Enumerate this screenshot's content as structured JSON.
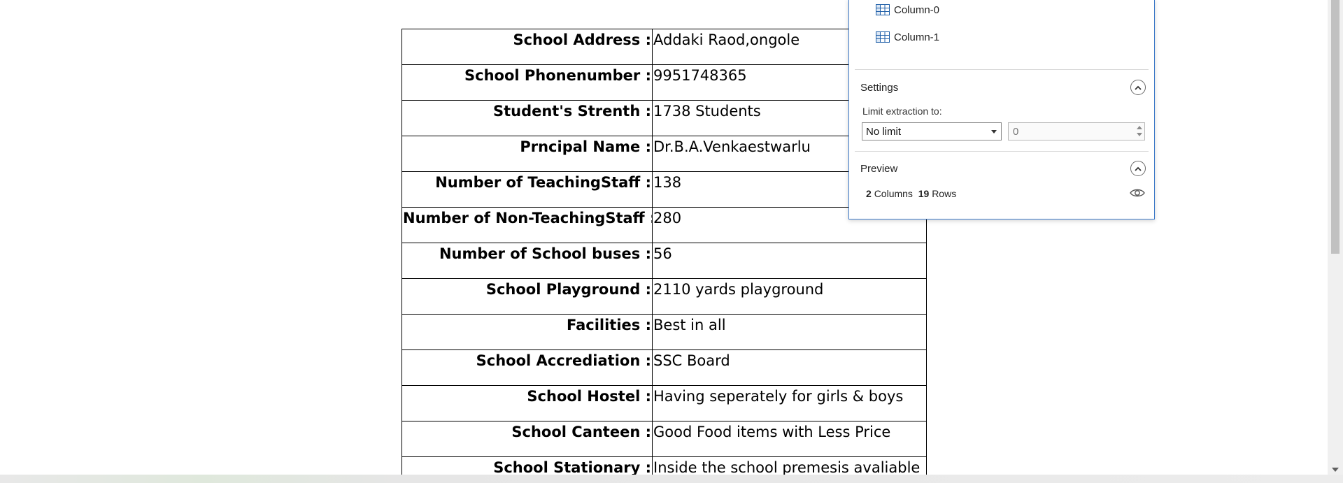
{
  "school_table": {
    "rows": [
      {
        "label": "School Address :",
        "value": "Addaki Raod,ongole"
      },
      {
        "label": "School Phonenumber :",
        "value": "9951748365"
      },
      {
        "label": "Student's Strenth :",
        "value": "1738 Students"
      },
      {
        "label": "Prncipal Name :",
        "value": "Dr.B.A.Venkaestwarlu"
      },
      {
        "label": "Number of TeachingStaff :",
        "value": "138"
      },
      {
        "label": "Number of Non-TeachingStaff :",
        "value": "280"
      },
      {
        "label": "Number of School buses :",
        "value": "56"
      },
      {
        "label": "School Playground :",
        "value": "2110 yards playground"
      },
      {
        "label": "Facilities :",
        "value": "Best in all"
      },
      {
        "label": "School Accrediation :",
        "value": "SSC Board"
      },
      {
        "label": "School Hostel :",
        "value": "Having seperately for girls & boys"
      },
      {
        "label": "School Canteen :",
        "value": "Good Food items with Less Price"
      },
      {
        "label": "School Stationary :",
        "value": "Inside the school premesis avaliable"
      }
    ]
  },
  "panel": {
    "columns": [
      {
        "label": "Column-0",
        "icon": "table-column-icon"
      },
      {
        "label": "Column-1",
        "icon": "table-column-icon"
      }
    ],
    "settings": {
      "title": "Settings",
      "limit_label": "Limit extraction to:",
      "limit_selected": "No limit",
      "limit_value_placeholder": "0"
    },
    "preview": {
      "title": "Preview",
      "columns_count": "2",
      "columns_word": "Columns",
      "rows_count": "19",
      "rows_word": "Rows"
    }
  },
  "colors": {
    "panel_border": "#3c78c8",
    "icon_blue": "#1f5fa8",
    "scroll_thumb": "#c1c1c1"
  }
}
